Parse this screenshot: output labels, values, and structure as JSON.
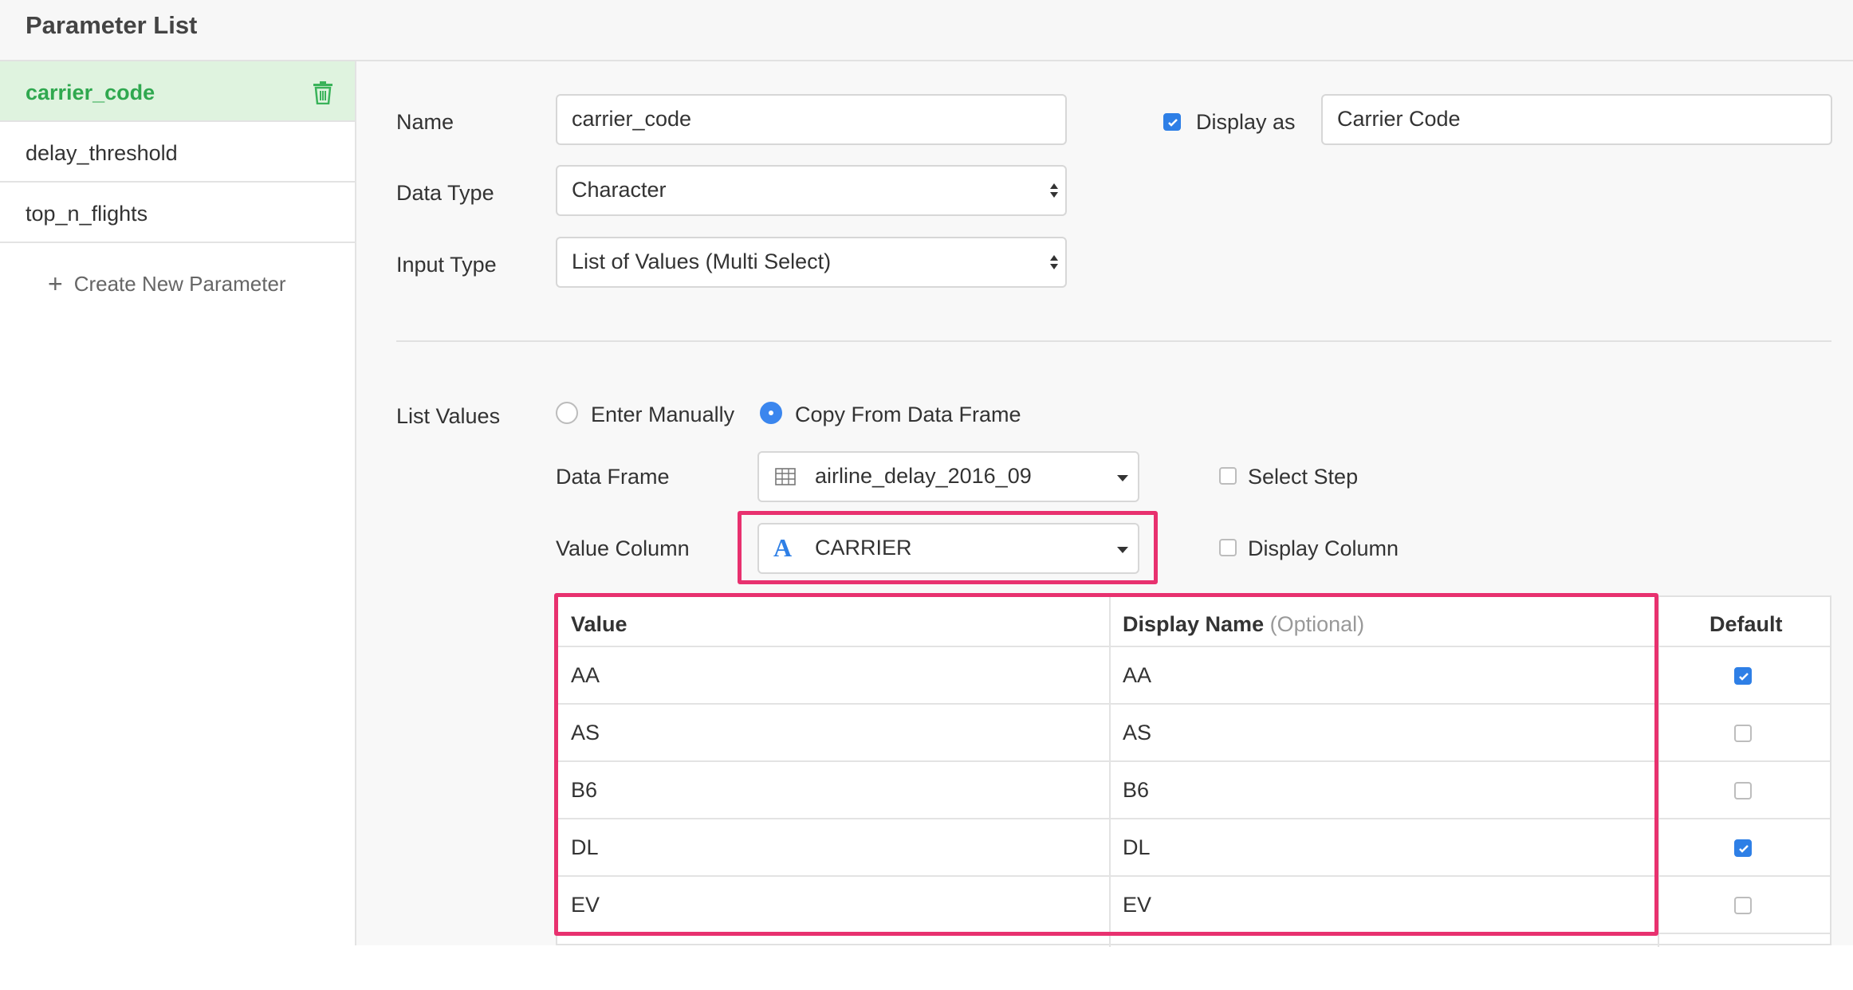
{
  "header": {
    "title": "Parameter List"
  },
  "sidebar": {
    "items": [
      {
        "label": "carrier_code",
        "active": true
      },
      {
        "label": "delay_threshold",
        "active": false
      },
      {
        "label": "top_n_flights",
        "active": false
      }
    ],
    "create_new": "Create New Parameter"
  },
  "form": {
    "name_label": "Name",
    "name_value": "carrier_code",
    "display_as_label": "Display as",
    "display_as_checked": true,
    "display_as_value": "Carrier Code",
    "data_type_label": "Data Type",
    "data_type_value": "Character",
    "input_type_label": "Input Type",
    "input_type_value": "List of Values (Multi Select)",
    "list_values_label": "List Values",
    "enter_manually_label": "Enter Manually",
    "copy_from_df_label": "Copy From Data Frame",
    "data_frame_label": "Data Frame",
    "data_frame_value": "airline_delay_2016_09",
    "select_step_label": "Select Step",
    "value_column_label": "Value Column",
    "value_column_value": "CARRIER",
    "value_column_icon_glyph": "A",
    "display_column_label": "Display Column"
  },
  "table": {
    "headers": {
      "value": "Value",
      "display_name": "Display Name",
      "display_name_hint": "(Optional)",
      "default": "Default"
    },
    "rows": [
      {
        "value": "AA",
        "display_name": "AA",
        "default": true
      },
      {
        "value": "AS",
        "display_name": "AS",
        "default": false
      },
      {
        "value": "B6",
        "display_name": "B6",
        "default": false
      },
      {
        "value": "DL",
        "display_name": "DL",
        "default": true
      },
      {
        "value": "EV",
        "display_name": "EV",
        "default": false
      }
    ]
  },
  "colors": {
    "accent_green": "#2fa84f",
    "active_bg": "#dff3df",
    "checkbox_blue": "#2e7fe6",
    "highlight_pink": "#e8316f"
  },
  "icons": {
    "trash": "trash-icon",
    "plus": "plus-icon",
    "table": "table-icon",
    "text_column": "text-column-icon"
  }
}
